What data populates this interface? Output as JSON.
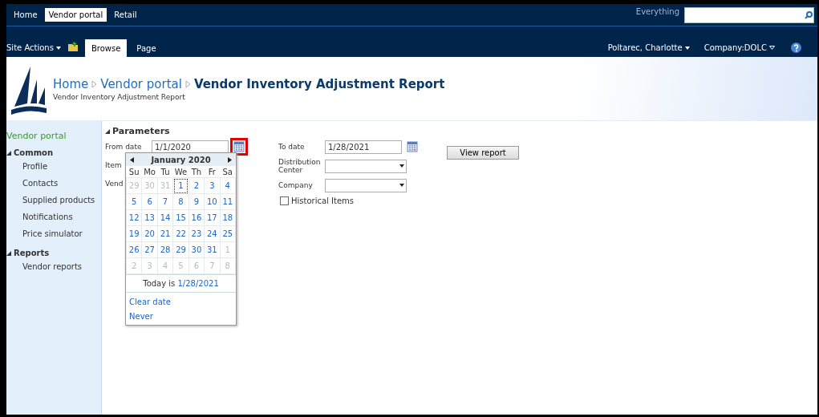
{
  "top_tabs": [
    {
      "label": "Home",
      "selected": false
    },
    {
      "label": "Vendor portal",
      "selected": true
    },
    {
      "label": "Retail",
      "selected": false
    }
  ],
  "search": {
    "scope": "Everything"
  },
  "ribbon": {
    "site_actions": "Site Actions",
    "tabs": [
      {
        "label": "Browse",
        "selected": true
      },
      {
        "label": "Page",
        "selected": false
      }
    ],
    "user": "Poltarec, Charlotte",
    "company": "Company:DOLC"
  },
  "header": {
    "breadcrumb": [
      "Home",
      "Vendor portal"
    ],
    "title": "Vendor Inventory Adjustment Report",
    "subtitle": "Vendor Inventory Adjustment Report"
  },
  "sidebar": {
    "title": "Vendor portal",
    "groups": [
      {
        "label": "Common",
        "expanded": true,
        "children": [
          {
            "label": "Profile"
          },
          {
            "label": "Contacts"
          },
          {
            "label": "Supplied products"
          },
          {
            "label": "Notifications"
          },
          {
            "label": "Price simulator"
          }
        ]
      },
      {
        "label": "Reports",
        "expanded": true,
        "children": [
          {
            "label": "Vendor reports"
          }
        ]
      }
    ]
  },
  "parameters": {
    "title": "Parameters",
    "left_fields": [
      {
        "label": "From date",
        "value": "1/1/2020",
        "kind": "date"
      },
      {
        "label": "Item",
        "kind": "hidden"
      },
      {
        "label": "Vend",
        "kind": "hidden"
      }
    ],
    "right_fields": [
      {
        "label": "To date",
        "value": "1/28/2021",
        "kind": "date"
      },
      {
        "label": "Distribution Center",
        "kind": "select"
      },
      {
        "label": "Company",
        "kind": "select"
      }
    ],
    "checkbox": {
      "label": "Historical Items",
      "checked": false
    },
    "button": "View report"
  },
  "calendar": {
    "month": "January 2020",
    "weekdays": [
      "Su",
      "Mo",
      "Tu",
      "We",
      "Th",
      "Fr",
      "Sa"
    ],
    "weeks": [
      [
        {
          "day": "29",
          "outside": true,
          "selected": false
        },
        {
          "day": "30",
          "outside": true,
          "selected": false
        },
        {
          "day": "31",
          "outside": true,
          "selected": false
        },
        {
          "day": "1",
          "outside": false,
          "selected": true
        },
        {
          "day": "2",
          "outside": false,
          "selected": false
        },
        {
          "day": "3",
          "outside": false,
          "selected": false
        },
        {
          "day": "4",
          "outside": false,
          "selected": false
        }
      ],
      [
        {
          "day": "5",
          "outside": false,
          "selected": false
        },
        {
          "day": "6",
          "outside": false,
          "selected": false
        },
        {
          "day": "7",
          "outside": false,
          "selected": false
        },
        {
          "day": "8",
          "outside": false,
          "selected": false
        },
        {
          "day": "9",
          "outside": false,
          "selected": false
        },
        {
          "day": "10",
          "outside": false,
          "selected": false
        },
        {
          "day": "11",
          "outside": false,
          "selected": false
        }
      ],
      [
        {
          "day": "12",
          "outside": false,
          "selected": false
        },
        {
          "day": "13",
          "outside": false,
          "selected": false
        },
        {
          "day": "14",
          "outside": false,
          "selected": false
        },
        {
          "day": "15",
          "outside": false,
          "selected": false
        },
        {
          "day": "16",
          "outside": false,
          "selected": false
        },
        {
          "day": "17",
          "outside": false,
          "selected": false
        },
        {
          "day": "18",
          "outside": false,
          "selected": false
        }
      ],
      [
        {
          "day": "19",
          "outside": false,
          "selected": false
        },
        {
          "day": "20",
          "outside": false,
          "selected": false
        },
        {
          "day": "21",
          "outside": false,
          "selected": false
        },
        {
          "day": "22",
          "outside": false,
          "selected": false
        },
        {
          "day": "23",
          "outside": false,
          "selected": false
        },
        {
          "day": "24",
          "outside": false,
          "selected": false
        },
        {
          "day": "25",
          "outside": false,
          "selected": false
        }
      ],
      [
        {
          "day": "26",
          "outside": false,
          "selected": false
        },
        {
          "day": "27",
          "outside": false,
          "selected": false
        },
        {
          "day": "28",
          "outside": false,
          "selected": false
        },
        {
          "day": "29",
          "outside": false,
          "selected": false
        },
        {
          "day": "30",
          "outside": false,
          "selected": false
        },
        {
          "day": "31",
          "outside": false,
          "selected": false
        },
        {
          "day": "1",
          "outside": true,
          "selected": false
        }
      ],
      [
        {
          "day": "2",
          "outside": true,
          "selected": false
        },
        {
          "day": "3",
          "outside": true,
          "selected": false
        },
        {
          "day": "4",
          "outside": true,
          "selected": false
        },
        {
          "day": "5",
          "outside": true,
          "selected": false
        },
        {
          "day": "6",
          "outside": true,
          "selected": false
        },
        {
          "day": "7",
          "outside": true,
          "selected": false
        },
        {
          "day": "8",
          "outside": true,
          "selected": false
        }
      ]
    ],
    "today_label": "Today is",
    "today": "1/28/2021",
    "links": [
      "Clear date",
      "Never"
    ]
  }
}
